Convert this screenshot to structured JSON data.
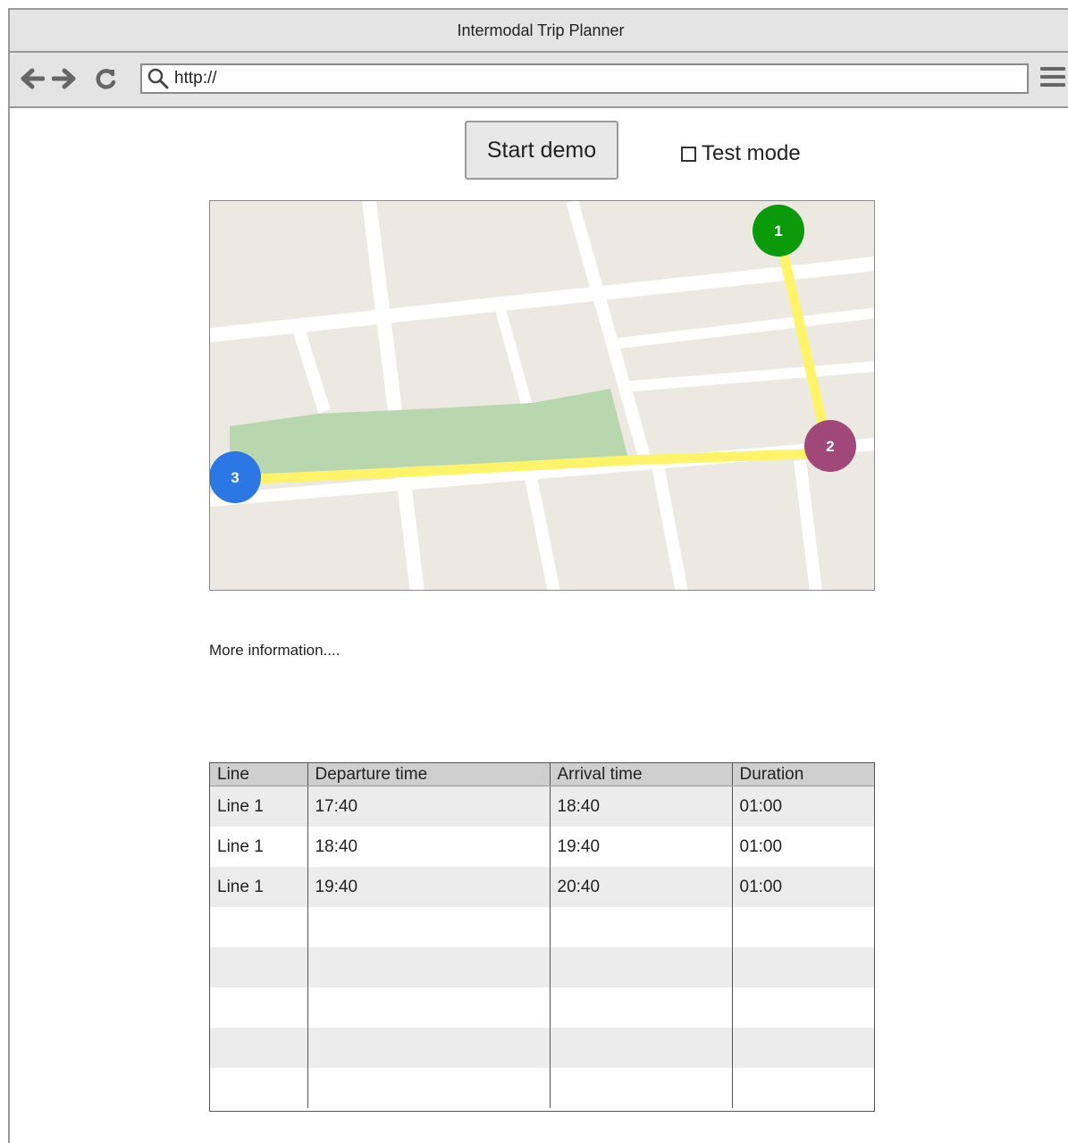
{
  "window": {
    "title": "Intermodal Trip Planner"
  },
  "toolbar": {
    "back_icon": "arrow-left-icon",
    "forward_icon": "arrow-right-icon",
    "reload_icon": "reload-icon",
    "url": "http://",
    "menu_icon": "hamburger-menu-icon"
  },
  "controls": {
    "start_demo_label": "Start demo",
    "test_mode_label": "Test mode",
    "test_mode_checked": false
  },
  "map": {
    "markers": [
      {
        "label": "1",
        "color": "#0a9a0a"
      },
      {
        "label": "2",
        "color": "#a0487a"
      },
      {
        "label": "3",
        "color": "#2b78e4"
      }
    ],
    "route_color": "#fff36a",
    "park_color": "#b9d7ae"
  },
  "more_info": "More information....",
  "schedule": {
    "headers": [
      "Line",
      "Departure time",
      "Arrival time",
      "Duration"
    ],
    "rows": [
      [
        "Line 1",
        "17:40",
        "18:40",
        "01:00"
      ],
      [
        "Line 1",
        "18:40",
        "19:40",
        "01:00"
      ],
      [
        "Line 1",
        "19:40",
        "20:40",
        "01:00"
      ],
      [
        "",
        "",
        "",
        ""
      ],
      [
        "",
        "",
        "",
        ""
      ],
      [
        "",
        "",
        "",
        ""
      ],
      [
        "",
        "",
        "",
        ""
      ],
      [
        "",
        "",
        "",
        ""
      ]
    ]
  }
}
